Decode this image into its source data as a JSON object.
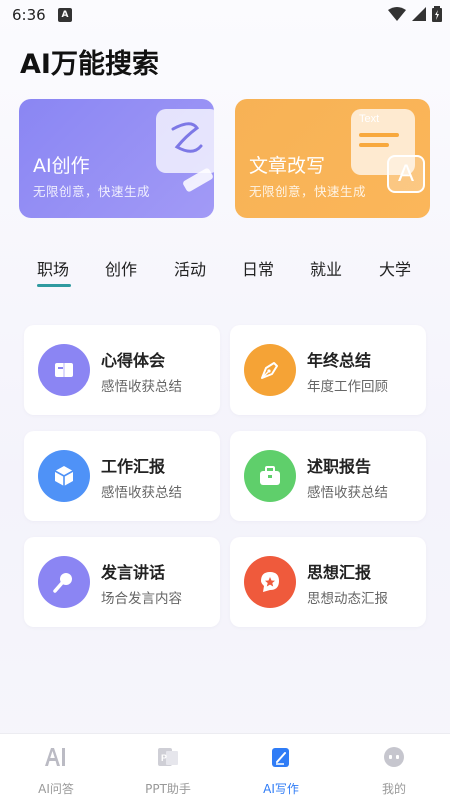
{
  "status_bar": {
    "time": "6:36",
    "notif_letter": "A"
  },
  "page_title": "AI万能搜索",
  "hero_cards": [
    {
      "title": "AI创作",
      "subtitle": "无限创意，快速生成"
    },
    {
      "title": "文章改写",
      "subtitle": "无限创意，快速生成",
      "badge_text": "Text",
      "badge_letter": "A"
    }
  ],
  "tabs": [
    "职场",
    "创作",
    "活动",
    "日常",
    "就业",
    "大学"
  ],
  "active_tab": "职场",
  "features": [
    {
      "title": "心得体会",
      "subtitle": "感悟收获总结",
      "icon": "book-icon",
      "color": "#8b85f3"
    },
    {
      "title": "年终总结",
      "subtitle": "年度工作回顾",
      "icon": "pen-nib-icon",
      "color": "#f5a336"
    },
    {
      "title": "工作汇报",
      "subtitle": "感悟收获总结",
      "icon": "cube-icon",
      "color": "#4f92f7"
    },
    {
      "title": "述职报告",
      "subtitle": "感悟收获总结",
      "icon": "briefcase-icon",
      "color": "#5fcf6b"
    },
    {
      "title": "发言讲话",
      "subtitle": "场合发言内容",
      "icon": "microphone-icon",
      "color": "#8b85f3"
    },
    {
      "title": "思想汇报",
      "subtitle": "思想动态汇报",
      "icon": "star-badge-icon",
      "color": "#ef5a3c"
    }
  ],
  "bottom_nav": [
    {
      "label": "AI问答",
      "icon": "ai-text-icon"
    },
    {
      "label": "PPT助手",
      "icon": "ppt-icon"
    },
    {
      "label": "AI写作",
      "icon": "write-icon"
    },
    {
      "label": "我的",
      "icon": "profile-icon"
    }
  ],
  "active_nav": "AI写作",
  "colors": {
    "accent_blue": "#2f7cf6",
    "tab_indicator": "#2f9aa0",
    "hero_purple": "#8a86f3",
    "hero_orange": "#f7b255"
  }
}
